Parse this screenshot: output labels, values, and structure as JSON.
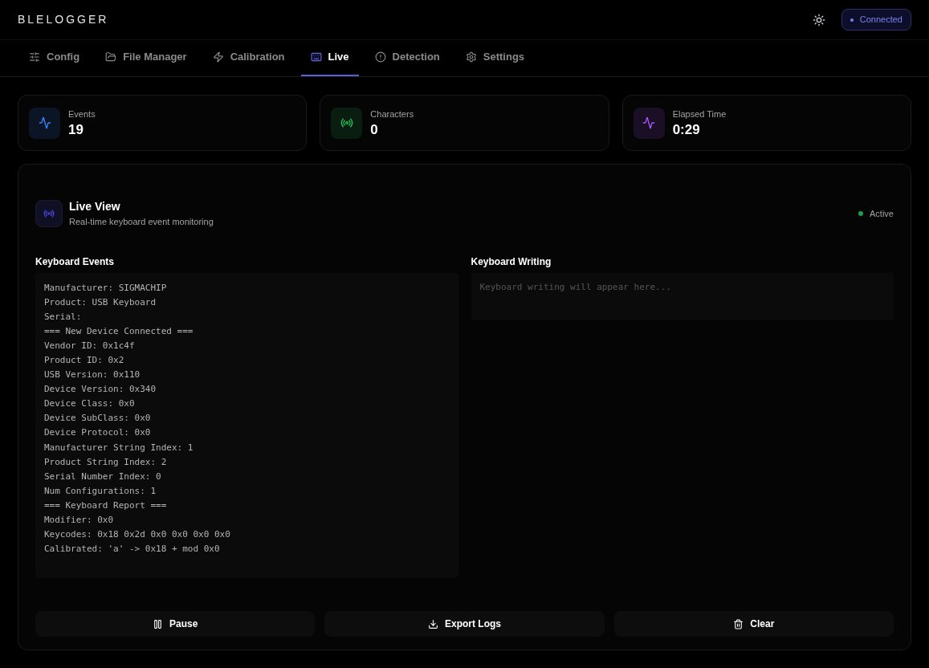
{
  "header": {
    "logo": "BLELOGGER",
    "status": {
      "label": "Connected",
      "connected": true
    }
  },
  "tabs": [
    {
      "label": "Config",
      "kind": "sliders",
      "selected": false
    },
    {
      "label": "File Manager",
      "kind": "folder",
      "selected": false
    },
    {
      "label": "Calibration",
      "kind": "zap",
      "selected": false
    },
    {
      "label": "Live",
      "kind": "keyboard",
      "selected": true
    },
    {
      "label": "Detection",
      "kind": "alert",
      "selected": false
    },
    {
      "label": "Settings",
      "kind": "gear",
      "selected": false
    }
  ],
  "stats": [
    {
      "label": "Events",
      "value": "19",
      "kind": "activity",
      "color": "#3b82f6"
    },
    {
      "label": "Characters",
      "value": "0",
      "kind": "radio",
      "color": "#22c55e"
    },
    {
      "label": "Elapsed Time",
      "value": "0:29",
      "kind": "activity",
      "color": "#a855f7"
    }
  ],
  "live_view": {
    "title": "Live View",
    "subtitle": "Real-time keyboard event monitoring",
    "status": {
      "label": "Active",
      "active": true
    },
    "events": {
      "title": "Keyboard Events",
      "lines": [
        "Manufacturer: SIGMACHIP",
        "Product: USB Keyboard",
        "Serial:",
        "=== New Device Connected ===",
        "Vendor ID: 0x1c4f",
        "Product ID: 0x2",
        "USB Version: 0x110",
        "Device Version: 0x340",
        "Device Class: 0x0",
        "Device SubClass: 0x0",
        "Device Protocol: 0x0",
        "Manufacturer String Index: 1",
        "Product String Index: 2",
        "Serial Number Index: 0",
        "Num Configurations: 1",
        "=== Keyboard Report ===",
        "Modifier: 0x0",
        "Keycodes: 0x18 0x2d 0x0 0x0 0x0 0x0",
        "Calibrated: 'a' -> 0x18 + mod 0x0"
      ]
    },
    "writing": {
      "title": "Keyboard Writing",
      "placeholder": "Keyboard writing will appear here..."
    },
    "buttons": [
      {
        "label": "Pause",
        "kind": "pause"
      },
      {
        "label": "Export Logs",
        "kind": "download"
      },
      {
        "label": "Clear",
        "kind": "trash"
      }
    ]
  }
}
